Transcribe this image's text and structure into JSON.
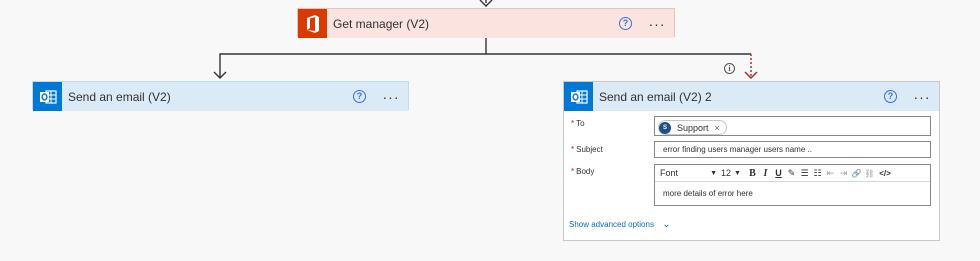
{
  "colors": {
    "office_orange": "#d83b01",
    "outlook_blue": "#0078d4",
    "manager_header_bg": "#fbe4df",
    "email_header_bg": "#dbeaf7",
    "link_blue": "#0f6cbd",
    "required_red": "#a4262c",
    "dashed_arrow_red": "#a4262c"
  },
  "get_manager": {
    "title": "Get manager (V2)",
    "icon": "office-icon",
    "help_label": "?",
    "more_label": "···"
  },
  "send_email_left": {
    "title": "Send an email (V2)",
    "icon": "outlook-icon",
    "help_label": "?",
    "more_label": "···"
  },
  "send_email_right": {
    "title": "Send an email (V2) 2",
    "icon": "outlook-icon",
    "help_label": "?",
    "more_label": "···",
    "info_label": "i",
    "fields": {
      "to": {
        "required_mark": "*",
        "label": "To",
        "token": {
          "initial": "S",
          "name": "Support",
          "remove": "×"
        }
      },
      "subject": {
        "required_mark": "*",
        "label": "Subject",
        "value": "error finding users manager users name .."
      },
      "body": {
        "required_mark": "*",
        "label": "Body",
        "font": "Font",
        "font_size": "12",
        "caret": "▼",
        "toolbar": {
          "bold": "B",
          "italic": "I",
          "underline": "U",
          "pen": "✎",
          "bullets": "☰",
          "numbered": "☷",
          "outdent": "⇤",
          "indent": "⇥",
          "link": "🔗",
          "unlink": "⛓",
          "code": "</>"
        },
        "value": "more details of error here"
      }
    },
    "advanced_options_label": "Show advanced options",
    "advanced_chevron": "⌄"
  }
}
